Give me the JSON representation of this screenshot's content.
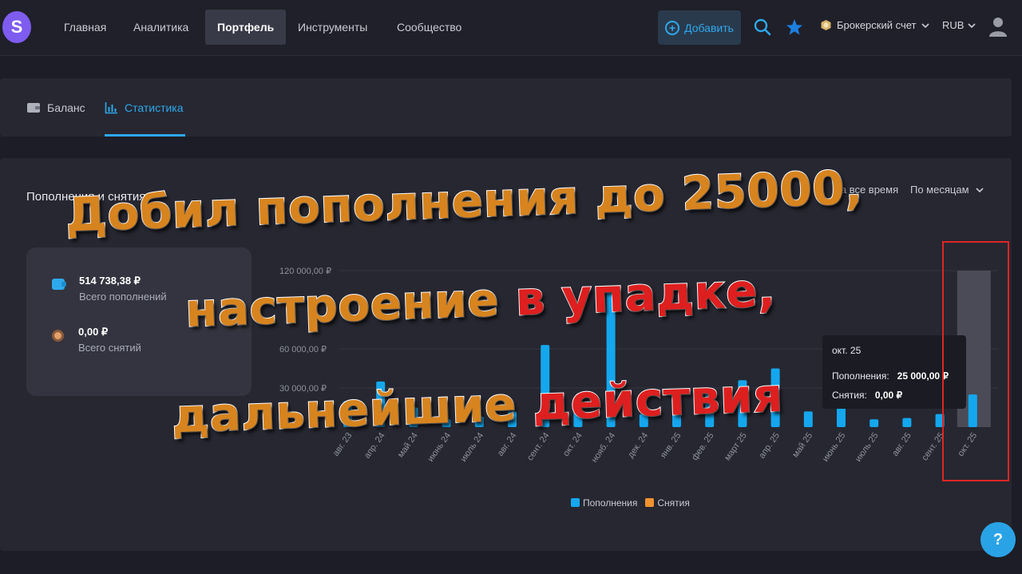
{
  "logo": {
    "letter": "S",
    "color": "#7e5cf0"
  },
  "nav": {
    "items": [
      {
        "label": "Главная",
        "active": false
      },
      {
        "label": "Аналитика",
        "active": false
      },
      {
        "label": "Портфель",
        "active": true
      },
      {
        "label": "Инструменты",
        "active": false
      },
      {
        "label": "Сообщество",
        "active": false
      }
    ],
    "add_label": "Добавить",
    "search_icon": "search-icon",
    "pin_icon": "star-icon",
    "account_label": "Брокерский счет",
    "currency_label": "RUB"
  },
  "tabs": [
    {
      "label": "Баланс",
      "icon": "wallet-icon",
      "active": false
    },
    {
      "label": "Статистика",
      "icon": "bar-chart-icon",
      "active": true
    }
  ],
  "stats": {
    "title": "Пополнения и снятия",
    "filter_a": "За все время",
    "filter_b": "По месяцам",
    "summary": {
      "deposits_value": "514 738,38 ₽",
      "deposits_label": "Всего пополнений",
      "withdrawals_value": "0,00 ₽",
      "withdrawals_label": "Всего снятий"
    },
    "tooltip": {
      "title": "окт. 25",
      "row1_label": "Пополнения:",
      "row1_value": "25 000,00 ₽",
      "row2_label": "Снятия:",
      "row2_value": "0,00 ₽"
    },
    "legend": [
      {
        "label": "Пополнения",
        "color": "#14a7ee"
      },
      {
        "label": "Снятия",
        "color": "#f0922e"
      }
    ]
  },
  "chart_data": {
    "type": "bar",
    "categories": [
      "авг. 23",
      "апр. 24",
      "май 24",
      "июнь 24",
      "июль 24",
      "авг. 24",
      "сент. 24",
      "окт. 24",
      "нояб. 24",
      "дек. 24",
      "янв. 25",
      "фев. 25",
      "март 25",
      "апр. 25",
      "май 25",
      "июнь 25",
      "июль 25",
      "авг. 25",
      "сент. 25",
      "окт. 25"
    ],
    "series": [
      {
        "name": "Пополнения",
        "color": "#14a7ee",
        "values": [
          20000,
          35000,
          15000,
          6000,
          8000,
          12000,
          63000,
          18000,
          105000,
          10000,
          20000,
          26000,
          36000,
          45000,
          12000,
          20000,
          6000,
          7000,
          10000,
          25000
        ]
      },
      {
        "name": "Снятия",
        "color": "#f0922e",
        "values": [
          0,
          0,
          0,
          0,
          0,
          0,
          0,
          0,
          0,
          0,
          0,
          0,
          0,
          0,
          0,
          0,
          0,
          0,
          0,
          0
        ]
      }
    ],
    "yticks": [
      "30 000,00 ₽",
      "60 000,00 ₽",
      "120 000,00 ₽"
    ],
    "ylim": [
      0,
      120000
    ],
    "highlighted_category": "окт. 25"
  },
  "overlay": {
    "line1": "Добил пополнения до 25000,",
    "line2a": "настроение",
    "line2b": "в упадке,",
    "line3a": "дальнейшие",
    "line3b": "действия"
  },
  "help_label": "?"
}
